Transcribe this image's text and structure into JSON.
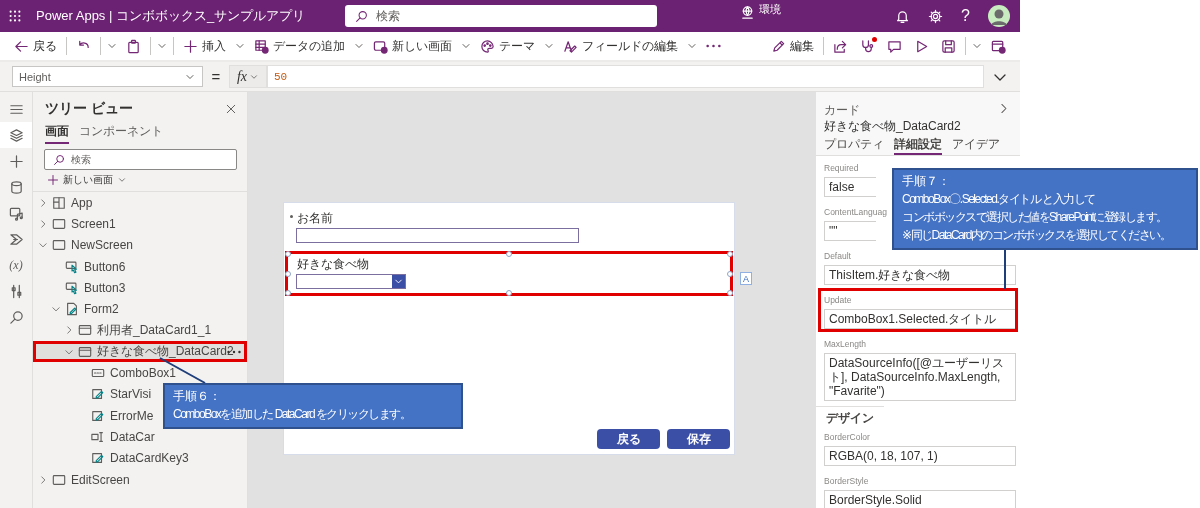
{
  "header": {
    "title": "Power Apps | コンボボックス_サンプルアプリ",
    "search": {
      "placeholder": "検索"
    },
    "environment": "環境",
    "help": "?"
  },
  "toolbar": {
    "left": [
      {
        "kind": "back",
        "label": "戻る",
        "menu": false,
        "split": false,
        "divider": true
      },
      {
        "kind": "undo",
        "menu": true,
        "split": true,
        "divider": false
      },
      {
        "kind": "paste",
        "menu": true,
        "split": true,
        "divider": true
      },
      {
        "kind": "plus",
        "label": "挿入",
        "menu": true,
        "split": false,
        "divider": false
      },
      {
        "kind": "table",
        "label": "データの追加",
        "menu": true,
        "split": false,
        "divider": false
      },
      {
        "kind": "screen",
        "label": "新しい画面",
        "menu": true,
        "split": false,
        "divider": false
      },
      {
        "kind": "palette",
        "label": "テーマ",
        "menu": true,
        "split": false,
        "divider": false
      },
      {
        "kind": "fields",
        "label": "フィールドの編集",
        "menu": true,
        "split": false,
        "divider": false
      },
      {
        "kind": "more",
        "menu": false,
        "split": false,
        "divider": false
      }
    ],
    "right": [
      {
        "kind": "pencil",
        "label": "編集",
        "alert": false,
        "menu": false,
        "split": false,
        "divider": true
      },
      {
        "kind": "share",
        "alert": false,
        "menu": false,
        "split": false,
        "divider": false
      },
      {
        "kind": "stethoscope",
        "alert": true,
        "menu": false,
        "split": false,
        "divider": false
      },
      {
        "kind": "comment",
        "alert": false,
        "menu": false,
        "split": false,
        "divider": false
      },
      {
        "kind": "play",
        "alert": false,
        "menu": false,
        "split": false,
        "divider": false
      },
      {
        "kind": "save",
        "alert": false,
        "menu": true,
        "split": true,
        "divider": false
      },
      {
        "kind": "publish",
        "alert": false,
        "menu": false,
        "split": false,
        "divider": false
      }
    ]
  },
  "formula_bar": {
    "property": "Height",
    "equals": "=",
    "fx": "fx",
    "formula": "50"
  },
  "rail": [
    {
      "kind": "menu",
      "selected": false
    },
    {
      "kind": "tree",
      "selected": true
    },
    {
      "kind": "plus",
      "selected": false
    },
    {
      "kind": "data",
      "selected": false
    },
    {
      "kind": "media",
      "selected": false
    },
    {
      "kind": "automate",
      "selected": false
    },
    {
      "kind": "variables",
      "label": "(x)",
      "selected": false
    },
    {
      "kind": "tools",
      "selected": false
    },
    {
      "kind": "search",
      "selected": false
    }
  ],
  "tree": {
    "title": "ツリー ビュー",
    "tabs": [
      {
        "label": "画面",
        "selected": true
      },
      {
        "label": "コンポーネント",
        "selected": false
      }
    ],
    "search": {
      "placeholder": "検索"
    },
    "new_screen": "新しい画面",
    "items": [
      {
        "kind": "app",
        "label": "App",
        "expanded": false,
        "selected": false
      },
      {
        "kind": "screen",
        "label": "Screen1",
        "expanded": false,
        "selected": false
      },
      {
        "kind": "screen",
        "label": "NewScreen",
        "expanded": true,
        "selected": false,
        "children": [
          {
            "kind": "button",
            "label": "Button6",
            "selected": false
          },
          {
            "kind": "button",
            "label": "Button3",
            "selected": false
          },
          {
            "kind": "form",
            "label": "Form2",
            "expanded": true,
            "selected": false,
            "children": [
              {
                "kind": "card",
                "label": "利用者_DataCard1_1",
                "expanded": false,
                "selected": false
              },
              {
                "kind": "card",
                "label": "好きな食べ物_DataCard2",
                "expanded": true,
                "selected": true,
                "children": [
                  {
                    "kind": "combobox",
                    "label": "ComboBox1",
                    "selected": false
                  },
                  {
                    "kind": "edit",
                    "label": "StarVisi",
                    "selected": false
                  },
                  {
                    "kind": "edit",
                    "label": "ErrorMe",
                    "selected": false
                  },
                  {
                    "kind": "input",
                    "label": "DataCar",
                    "selected": false
                  },
                  {
                    "kind": "edit",
                    "label": "DataCardKey3",
                    "selected": false
                  }
                ]
              }
            ]
          }
        ]
      },
      {
        "kind": "screen",
        "label": "EditScreen",
        "expanded": false,
        "selected": false
      }
    ]
  },
  "canvas": {
    "fields": [
      {
        "kind": "text",
        "label": "お名前",
        "required": true,
        "selected": false
      },
      {
        "kind": "combo",
        "label": "好きな食べ物",
        "required": false,
        "selected": true
      }
    ],
    "buttons": [
      "戻る",
      "保存"
    ],
    "badge": "A"
  },
  "properties": {
    "label": "カード",
    "title": "好きな食べ物_DataCard2",
    "tabs": [
      {
        "label": "プロパティ",
        "selected": false
      },
      {
        "label": "詳細設定",
        "selected": true
      },
      {
        "label": "アイデア",
        "selected": false
      }
    ],
    "items": [
      {
        "name": "Required",
        "value": "false",
        "highlighted": false
      },
      {
        "name": "ContentLanguag",
        "value": "\"\"",
        "highlighted": false
      },
      {
        "name": "Default",
        "value": "ThisItem.好きな食べ物",
        "highlighted": false
      },
      {
        "name": "Update",
        "value": "ComboBox1.Selected.タイトル",
        "highlighted": true
      },
      {
        "name": "MaxLength",
        "value": "DataSourceInfo([@ユーザーリスト], DataSourceInfo.MaxLength, \"Favarite\")",
        "highlighted": false
      }
    ],
    "design": {
      "heading": "デザイン",
      "items": [
        {
          "name": "BorderColor",
          "value": "RGBA(0, 18, 107, 1)",
          "highlighted": false
        },
        {
          "name": "BorderStyle",
          "value": "BorderStyle.Solid",
          "highlighted": false
        }
      ]
    }
  },
  "callouts": [
    {
      "title": "手順６：",
      "lines": [
        "ComboBoxを追加した DataCard をクリックします。"
      ]
    },
    {
      "title": "手順７：",
      "lines": [
        "ComboBox〇.Selected.タイトル と入力して",
        "コンボボックスで選択した値をSharePointに登録します。",
        "※同じDataCard内のコンボボックスを選択してください。"
      ]
    }
  ]
}
